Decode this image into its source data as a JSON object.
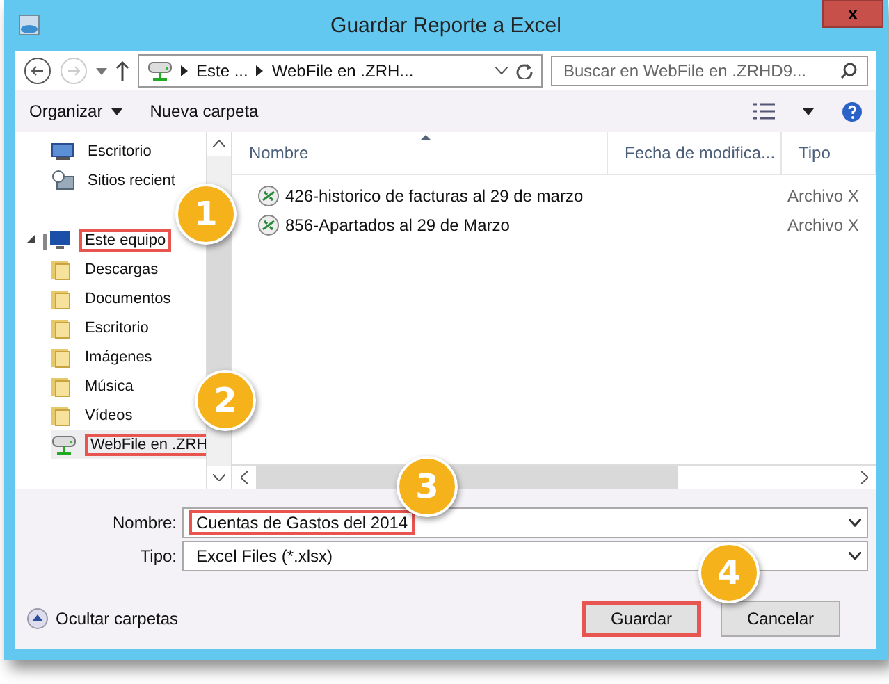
{
  "window": {
    "title": "Guardar Reporte a Excel",
    "close": "x"
  },
  "address": {
    "crumbs": [
      "Este ...",
      "WebFile en .ZRH..."
    ]
  },
  "search": {
    "placeholder": "Buscar en WebFile en .ZRHD9..."
  },
  "toolbar": {
    "organize": "Organizar",
    "new_folder": "Nueva carpeta"
  },
  "sidebar": {
    "items": [
      {
        "label": "Escritorio",
        "kind": "desktop",
        "selected": false,
        "highlighted": false
      },
      {
        "label": "Sitios recient",
        "kind": "recent",
        "selected": false,
        "highlighted": false
      },
      {
        "label": "Este equipo",
        "kind": "computer",
        "selected": false,
        "highlighted": true,
        "expanded": true,
        "children": [
          {
            "label": "Descargas",
            "kind": "folder",
            "selected": false,
            "highlighted": false
          },
          {
            "label": "Documentos",
            "kind": "folder",
            "selected": false,
            "highlighted": false
          },
          {
            "label": "Escritorio",
            "kind": "folder",
            "selected": false,
            "highlighted": false
          },
          {
            "label": "Imágenes",
            "kind": "folder",
            "selected": false,
            "highlighted": false
          },
          {
            "label": "Música",
            "kind": "folder",
            "selected": false,
            "highlighted": false
          },
          {
            "label": "Vídeos",
            "kind": "folder",
            "selected": false,
            "highlighted": false
          },
          {
            "label": "WebFile en .ZRH",
            "kind": "network",
            "selected": true,
            "highlighted": true
          }
        ]
      }
    ]
  },
  "table": {
    "columns": [
      "Nombre",
      "Fecha de modifica...",
      "Tipo"
    ],
    "rows": [
      {
        "name": "426-historico de facturas al 29 de marzo",
        "type": "Archivo X"
      },
      {
        "name": "856-Apartados al 29 de Marzo",
        "type": "Archivo X"
      }
    ]
  },
  "form": {
    "name_label": "Nombre:",
    "name_value": "Cuentas de Gastos del 2014",
    "name_highlighted": true,
    "type_label": "Tipo:",
    "type_value": "Excel Files (*.xlsx)"
  },
  "footer": {
    "hide_folders": "Ocultar carpetas",
    "save": "Guardar",
    "save_highlighted": true,
    "cancel": "Cancelar"
  },
  "callouts": [
    {
      "label": "1"
    },
    {
      "label": "2"
    },
    {
      "label": "3"
    },
    {
      "label": "4"
    }
  ]
}
